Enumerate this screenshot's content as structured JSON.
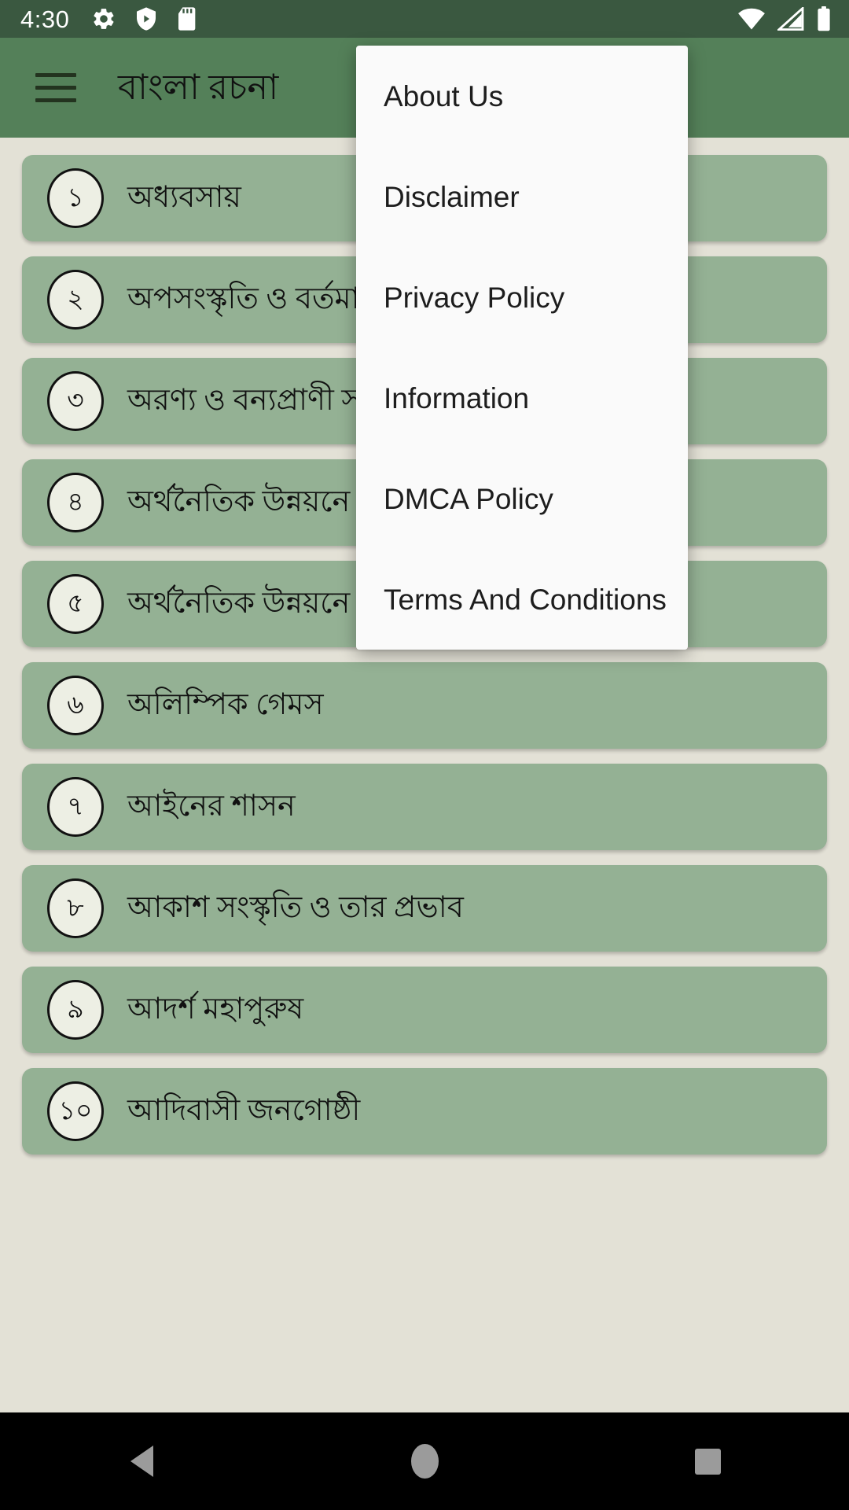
{
  "status_bar": {
    "clock": "4:30",
    "left_icons": [
      "gear-icon",
      "play-shield-icon",
      "sd-card-icon"
    ],
    "right_icons": [
      "wifi-icon",
      "cellular-signal-icon",
      "battery-icon"
    ],
    "background_color": "#3A5840"
  },
  "app_bar": {
    "menu_icon": "hamburger-icon",
    "title": "বাংলা রচনা",
    "background_color": "#548059"
  },
  "theme": {
    "page_background": "#E3E1D6",
    "card_background": "#94B194",
    "badge_background": "#EDEFE4",
    "menu_background": "#FAFAFA",
    "text_color": "#111111"
  },
  "essay_list": {
    "items": [
      {
        "number": "১",
        "title": "অধ্যবসায়"
      },
      {
        "number": "২",
        "title": "অপসংস্কৃতি ও বর্তমান"
      },
      {
        "number": "৩",
        "title": "অরণ্য ও বন্যপ্রাণী সংরক্ষণ"
      },
      {
        "number": "৪",
        "title": "অর্থনৈতিক উন্নয়নে নারী"
      },
      {
        "number": "৫",
        "title": "অর্থনৈতিক উন্নয়নে যোগাযোগ ব্যবস্থা"
      },
      {
        "number": "৬",
        "title": "অলিম্পিক গেমস"
      },
      {
        "number": "৭",
        "title": "আইনের শাসন"
      },
      {
        "number": "৮",
        "title": "আকাশ সংস্কৃতি ও তার প্রভাব"
      },
      {
        "number": "৯",
        "title": "আদর্শ মহাপুরুষ"
      },
      {
        "number": "১০",
        "title": "আদিবাসী জনগোষ্ঠী"
      }
    ]
  },
  "overflow_menu": {
    "visible": true,
    "items": [
      {
        "label": "About Us"
      },
      {
        "label": "Disclaimer"
      },
      {
        "label": "Privacy Policy"
      },
      {
        "label": "Information"
      },
      {
        "label": "DMCA Policy"
      },
      {
        "label": "Terms And Conditions"
      }
    ]
  },
  "nav_bar": {
    "back_label": "Back",
    "home_label": "Home",
    "recents_label": "Recents",
    "background_color": "#000000"
  }
}
